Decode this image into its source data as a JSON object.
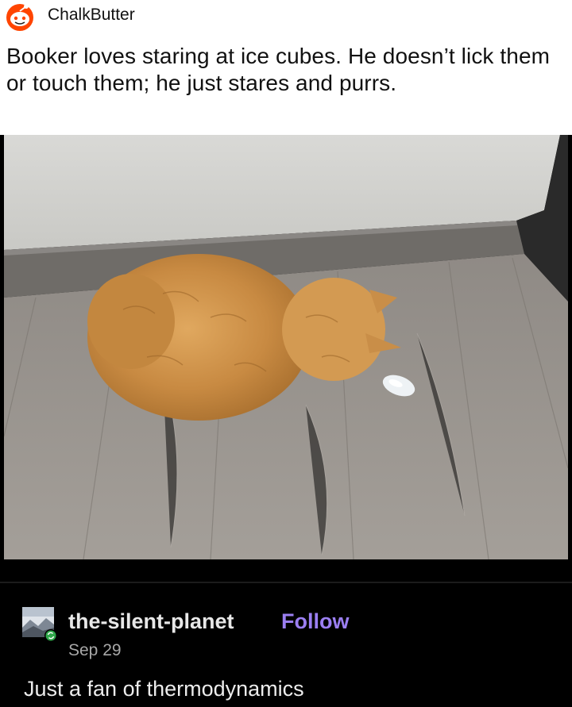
{
  "reddit_post": {
    "username": "ChalkButter",
    "title": "Booker loves staring at ice cubes. He doesn’t lick them or touch them; he just stares and purrs."
  },
  "tumblr_reply": {
    "blog_name": "the-silent-planet",
    "follow_label": "Follow",
    "date": "Sep 29",
    "text": "Just a fan of thermodynamics"
  },
  "colors": {
    "follow": "#9b7ff2",
    "reddit_orange": "#ff4500"
  },
  "icons": {
    "reddit_avatar": "snoo-avatar-icon",
    "tumblr_avatar": "landscape-avatar-icon",
    "reblog_badge": "reblog-icon"
  }
}
